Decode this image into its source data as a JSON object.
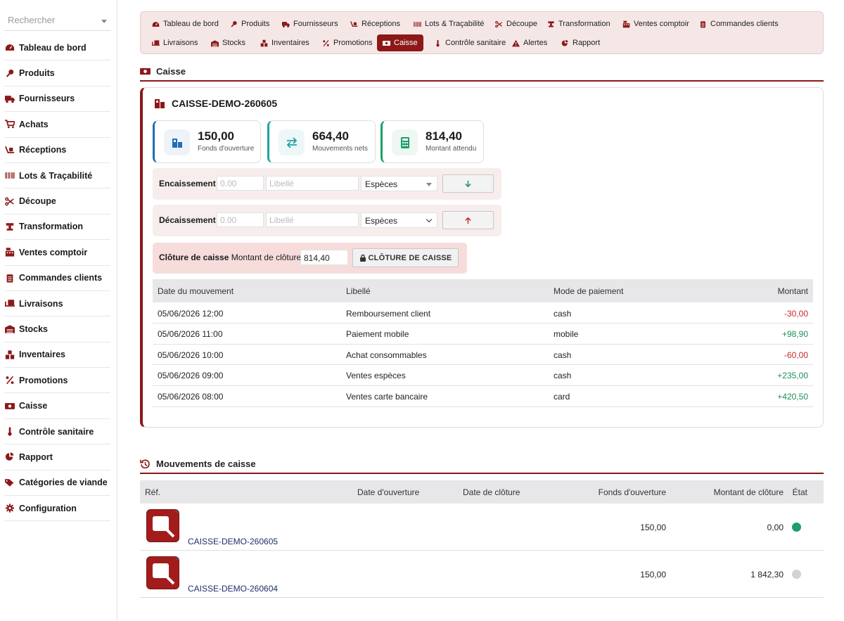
{
  "search": {
    "placeholder": "Rechercher"
  },
  "sidebar": {
    "items": [
      {
        "label": "Tableau de bord",
        "icon": "dashboard-icon"
      },
      {
        "label": "Produits",
        "icon": "drumstick-icon"
      },
      {
        "label": "Fournisseurs",
        "icon": "truck-icon"
      },
      {
        "label": "Achats",
        "icon": "cart-icon"
      },
      {
        "label": "Réceptions",
        "icon": "dolly-icon"
      },
      {
        "label": "Lots & Traçabilité",
        "icon": "barcode-icon"
      },
      {
        "label": "Découpe",
        "icon": "scissors-icon"
      },
      {
        "label": "Transformation",
        "icon": "grinder-icon"
      },
      {
        "label": "Ventes comptoir",
        "icon": "cash-register-icon"
      },
      {
        "label": "Commandes clients",
        "icon": "clipboard-icon"
      },
      {
        "label": "Livraisons",
        "icon": "shipping-icon"
      },
      {
        "label": "Stocks",
        "icon": "warehouse-icon"
      },
      {
        "label": "Inventaires",
        "icon": "boxes-icon"
      },
      {
        "label": "Promotions",
        "icon": "percent-icon"
      },
      {
        "label": "Caisse",
        "icon": "money-icon"
      },
      {
        "label": "Contrôle sanitaire",
        "icon": "thermometer-icon"
      },
      {
        "label": "Rapport",
        "icon": "pie-chart-icon"
      },
      {
        "label": "Catégories de viande",
        "icon": "tags-icon"
      },
      {
        "label": "Configuration",
        "icon": "gear-icon"
      }
    ]
  },
  "tabs": {
    "row1": [
      {
        "label": "Tableau de bord"
      },
      {
        "label": "Produits"
      },
      {
        "label": "Fournisseurs"
      },
      {
        "label": "Réceptions"
      },
      {
        "label": "Lots & Traçabilité"
      },
      {
        "label": "Découpe"
      },
      {
        "label": "Transformation"
      },
      {
        "label": "Ventes comptoir"
      },
      {
        "label": "Commandes clients"
      }
    ],
    "row2": [
      {
        "label": "Livraisons"
      },
      {
        "label": "Stocks"
      },
      {
        "label": "Inventaires"
      },
      {
        "label": "Promotions"
      },
      {
        "label": "Caisse"
      },
      {
        "label": "Contrôle sanitaire"
      },
      {
        "label": "Alertes"
      },
      {
        "label": "Rapport"
      }
    ]
  },
  "page": {
    "title": "Caisse"
  },
  "register": {
    "name": "CAISSE-DEMO-260605",
    "stats": [
      {
        "value": "150,00",
        "label": "Fonds d'ouverture"
      },
      {
        "value": "664,40",
        "label": "Mouvements nets"
      },
      {
        "value": "814,40",
        "label": "Montant attendu"
      }
    ],
    "cash_in": {
      "label": "Encaissement",
      "amount_placeholder": "0.00",
      "label_placeholder": "Libellé",
      "method": "Espèces"
    },
    "cash_out": {
      "label": "Décaissement",
      "amount_placeholder": "0.00",
      "label_placeholder": "Libellé",
      "method": "Espèces"
    },
    "closing": {
      "label": "Clôture de caisse",
      "amount_label": "Montant de clôture",
      "amount": "814,40",
      "button": "CLÔTURE DE CAISSE"
    },
    "movements_table": {
      "headers": [
        "Date du mouvement",
        "Libellé",
        "Mode de paiement",
        "Montant"
      ],
      "rows": [
        {
          "date": "05/06/2026 12:00",
          "label": "Remboursement client",
          "method": "cash",
          "amount": "-30,00"
        },
        {
          "date": "05/06/2026 11:00",
          "label": "Paiement mobile",
          "method": "mobile",
          "amount": "+98,90"
        },
        {
          "date": "05/06/2026 10:00",
          "label": "Achat consommables",
          "method": "cash",
          "amount": "-60,00"
        },
        {
          "date": "05/06/2026 09:00",
          "label": "Ventes espèces",
          "method": "cash",
          "amount": "+235,00"
        },
        {
          "date": "05/06/2026 08:00",
          "label": "Ventes carte bancaire",
          "method": "card",
          "amount": "+420,50"
        }
      ]
    }
  },
  "sessions": {
    "title": "Mouvements de caisse",
    "headers": [
      "Réf.",
      "Date d'ouverture",
      "Date de clôture",
      "Fonds d'ouverture",
      "Montant de clôture",
      "État"
    ],
    "rows": [
      {
        "ref": "CAISSE-DEMO-260605",
        "opening": "",
        "closing": "",
        "fund": "150,00",
        "closing_amount": "0,00",
        "state_color": "#1e9e6a"
      },
      {
        "ref": "CAISSE-DEMO-260604",
        "opening": "",
        "closing": "",
        "fund": "150,00",
        "closing_amount": "1 842,30",
        "state_color": "#cfd3d3"
      }
    ]
  },
  "colors": {
    "brand": "#8c1818",
    "positive": "#1e8e5a",
    "negative": "#c62828"
  }
}
